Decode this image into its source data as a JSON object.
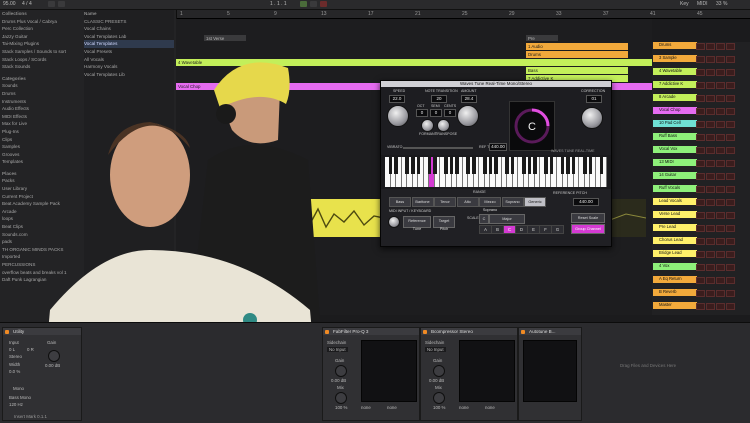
{
  "transport": {
    "tempo": "95.00",
    "signature": "4 / 4",
    "position": "1 . 1 . 1",
    "key": "Key",
    "midi": "MIDI",
    "cpu": "33 %",
    "ruler_marks": [
      "1",
      "5",
      "9",
      "13",
      "17",
      "21",
      "25",
      "29",
      "33",
      "37",
      "41",
      "45"
    ]
  },
  "browser": {
    "collections_header": "Collections",
    "collections": [
      "Drums Plus Vocal / Cabrya",
      "Perc Collection",
      "Jazzy Guitar",
      "Tai-Mixing Plugins",
      "Stack Samples / Sounds to sort",
      "Stack Loops / SCords",
      "Stack Sounds"
    ],
    "categories_header": "Categories",
    "categories": [
      "Sounds",
      "Drums",
      "Instruments",
      "Audio Effects",
      "MIDI Effects",
      "Max for Live",
      "Plug-Ins",
      "Clips",
      "Samples",
      "Grooves",
      "Templates"
    ],
    "places_header": "Places",
    "places": [
      "Packs",
      "User Library",
      "Current Project",
      "Beat Academy Sample Pack",
      "Arcade",
      "loops",
      "Beat Clips",
      "Sounds.com",
      "pads",
      "TH ORGANIC MINDS PACKS",
      "Imported",
      "PERCUSSIONS",
      "overflow beats and breaks vol 1",
      "Daft Punk Lagrangian"
    ],
    "col2_header": "Name",
    "col2": [
      "CLASSIC PRESETS",
      "Vocal Chains",
      "Vocal Templates Lab",
      "Vocal Templates",
      "Vocal Presets",
      "All Vocals",
      "Harmony Vocals",
      "Vocal Templates Lib"
    ]
  },
  "arrangement": {
    "scene_label": "1st Verse",
    "scene_label2": "Pre",
    "clips": [
      {
        "label": "1 Audio",
        "color": "#f2a93b"
      },
      {
        "label": "Drums",
        "color": "#f2a93b"
      },
      {
        "label": "4 Wavetable",
        "color": "#c3ef5a"
      },
      {
        "label": "Bass",
        "color": "#c3ef5a"
      },
      {
        "label": "7 Addictive K",
        "color": "#c3ef5a"
      },
      {
        "label": "Vocal Chop",
        "color": "#e56bf0"
      }
    ]
  },
  "tracks": [
    {
      "name": "Drums",
      "color": "#f2a93b"
    },
    {
      "name": "3 Sample",
      "color": "#f2a93b"
    },
    {
      "name": "4 Wavetable",
      "color": "#c3ef5a"
    },
    {
      "name": "7 Addictive K",
      "color": "#c3ef5a"
    },
    {
      "name": "8 Arcade",
      "color": "#c3ef5a"
    },
    {
      "name": "Vocal Chop",
      "color": "#e56bf0"
    },
    {
      "name": "10 Pad Cell",
      "color": "#6fe0d4"
    },
    {
      "name": "Ruff Bass",
      "color": "#8ef07a"
    },
    {
      "name": "Vocal Vox",
      "color": "#8ef07a"
    },
    {
      "name": "13 MIDI",
      "color": "#8ef07a"
    },
    {
      "name": "14 Guitar",
      "color": "#8ef07a"
    },
    {
      "name": "Ruff Vocals",
      "color": "#8ef07a"
    },
    {
      "name": "Lead Vocals",
      "color": "#fff06a"
    },
    {
      "name": "Verse Lead",
      "color": "#fff06a"
    },
    {
      "name": "Pre Lead",
      "color": "#fff06a"
    },
    {
      "name": "Chorus Lead",
      "color": "#fff06a"
    },
    {
      "name": "Bridge Lead",
      "color": "#fff06a"
    },
    {
      "name": "4 Vox",
      "color": "#8ef07a"
    },
    {
      "name": "A Eq Return",
      "color": "#f2a93b"
    },
    {
      "name": "B Reverb",
      "color": "#f2a93b"
    },
    {
      "name": "Master",
      "color": "#f2a93b"
    }
  ],
  "plugin": {
    "title": "Waves Tune Real-Time Mono/Stereo",
    "speed_label": "Speed",
    "speed": "22.0",
    "note_tr_label": "Note Transition",
    "note_tr_val": "20",
    "formant_label": "Formant",
    "transpose_label": "Transpose",
    "detune_label": "Detune",
    "oct_label": "OCT",
    "oct_val": "0",
    "semi_label": "Semi",
    "semi_val": "0",
    "cents_label": "Cents",
    "cents_val": "0",
    "vibrato_label": "Vibrato",
    "ref_label": "Ref Tune",
    "ref_val": "440.00",
    "amount_label": "Amount",
    "amount": "28.4",
    "center_label": "C",
    "correction_label": "Correction",
    "correction_val": "01",
    "brand": "WAVES TUNE REAL-TIME",
    "range_label": "Range",
    "ranges": [
      "Bass",
      "Baritone",
      "Tenor",
      "Alto",
      "Mezzo Soprano",
      "Soprano",
      "Generic"
    ],
    "range_selected": "Generic",
    "reference_label": "Reference Pitch",
    "reference_val": "440.00",
    "midi_label": "MIDI Input / Keyboard",
    "ref_tune_btn": "Reference Tune",
    "target_btn": "Target Pitch",
    "scale_label": "Scale",
    "key_val": "C",
    "scale_val": "Major",
    "scale_notes": [
      "A",
      "B",
      "C",
      "D",
      "E",
      "F",
      "G"
    ],
    "scale_selected": "C",
    "reset_btn": "Reset Scale",
    "group_btn": "Group Channel"
  },
  "devices": {
    "utility_title": "Utility",
    "input_label": "Input",
    "input_val": "0 L",
    "output_val": "0 R",
    "stereo_label": "Stereo",
    "width_label": "Width",
    "width_val": "0.0 %",
    "mono_label": "Mono",
    "bass_label": "Bass Mono",
    "bass_val": "120 Hz",
    "gain_label": "Gain",
    "gain_val": "0.00 dB",
    "fab_title": "FabFilter Pro-Q 3",
    "sidechain_label": "Sidechain",
    "sidechain_val": "No Input",
    "gain2_label": "Gain",
    "gain2_val": "0.00 dB",
    "mix_label": "Mix",
    "mix_val": "100 %",
    "comp_title": "Bcompressor Stereo",
    "auto_title": "Autotune B...",
    "none_val": "none",
    "bottom_label": "Insert Mark 0.1.1",
    "browser_bottom": "Drag Files and Devices Here"
  }
}
